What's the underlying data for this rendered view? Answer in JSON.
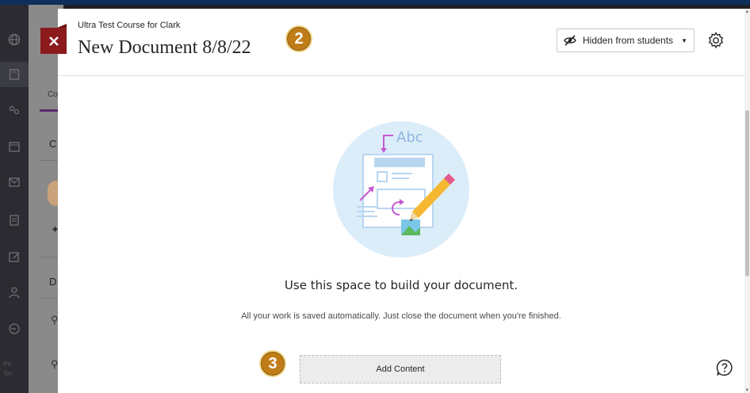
{
  "nav_icons": [
    "globe-icon",
    "courses-icon",
    "people-icon",
    "calendar-icon",
    "messages-icon",
    "grades-icon",
    "tools-icon",
    "profile-icon",
    "signout-icon"
  ],
  "course_background": {
    "tab_label": "Co",
    "section_1": "C",
    "section_2": "D",
    "footer_1": "Pri",
    "footer_2": "Ter"
  },
  "header": {
    "course_name": "Ultra Test Course for Clark",
    "title": "New Document 8/8/22",
    "visibility_label": "Hidden from students",
    "close_icon": "close-icon",
    "settings_icon": "gear-icon"
  },
  "badges": {
    "step_2": "2",
    "step_3": "3"
  },
  "empty_state": {
    "heading": "Use this space to build your document.",
    "description": "All your work is saved automatically. Just close the document when you're finished.",
    "illustration_text": "Abc"
  },
  "actions": {
    "add_content_label": "Add Content",
    "help_icon": "help-icon"
  },
  "colors": {
    "close_bg": "#8b1a1d",
    "badge": "#c07d17",
    "accent_purple": "#c45ad1",
    "illustration_bg": "#d9ecfa"
  }
}
